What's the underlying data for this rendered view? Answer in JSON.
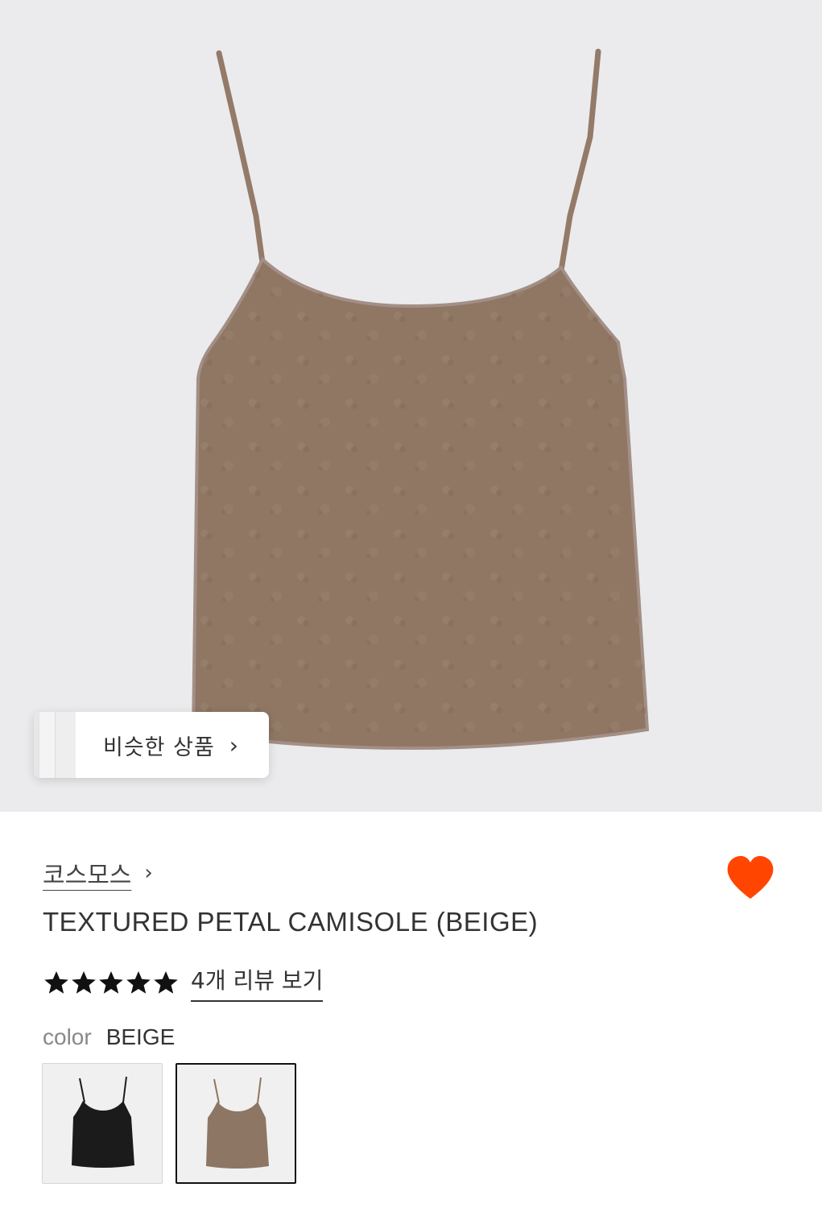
{
  "similar": {
    "label": "비슷한 상품",
    "chevron": "›"
  },
  "brand": {
    "name": "코스모스",
    "chevron": "›"
  },
  "product": {
    "title": "TEXTURED PETAL CAMISOLE (BEIGE)"
  },
  "rating": {
    "stars": 5,
    "max": 5,
    "reviews_link": "4개 리뷰 보기"
  },
  "color": {
    "key": "color",
    "value": "BEIGE"
  },
  "swatches": [
    {
      "name": "black",
      "color": "#1b1b1b",
      "selected": false
    },
    {
      "name": "beige",
      "color": "#8d7663",
      "selected": true
    }
  ],
  "wishlist": {
    "active": true,
    "color": "#ff4500"
  },
  "garment_color": "#8f7764",
  "hero_bg": "#ebebed"
}
